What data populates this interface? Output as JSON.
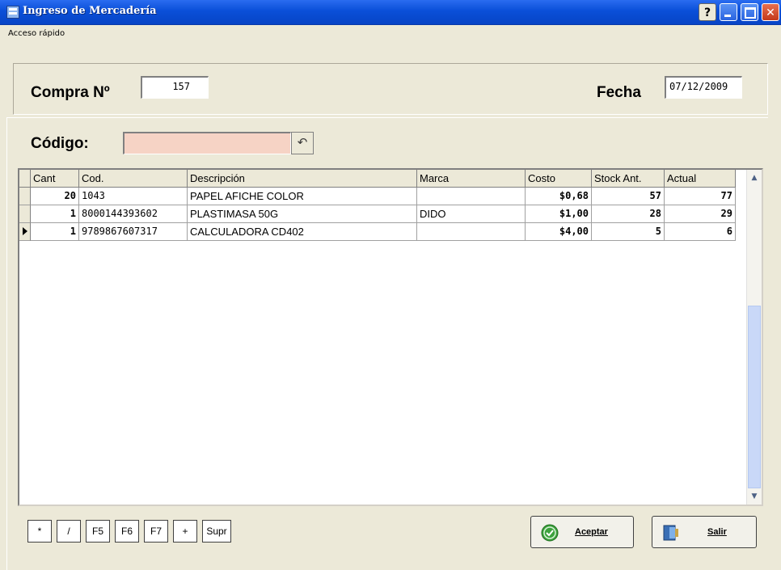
{
  "window": {
    "title": "Ingreso de Mercadería",
    "help_label": "?"
  },
  "menu": {
    "quick_access": "Acceso rápido"
  },
  "header": {
    "compra_label": "Compra Nº",
    "compra_value": "157",
    "fecha_label": "Fecha",
    "fecha_value": "07/12/2009"
  },
  "code": {
    "label": "Código:",
    "value": ""
  },
  "grid": {
    "columns": [
      "Cant",
      "Cod.",
      "Descripción",
      "Marca",
      "Costo",
      "Stock Ant.",
      "Actual"
    ],
    "rows": [
      {
        "cant": "20",
        "cod": "1043",
        "descripcion": "PAPEL AFICHE COLOR",
        "marca": "",
        "costo": "$0,68",
        "stock_ant": "57",
        "actual": "77"
      },
      {
        "cant": "1",
        "cod": "8000144393602",
        "descripcion": "PLASTIMASA 50G",
        "marca": "DIDO",
        "costo": "$1,00",
        "stock_ant": "28",
        "actual": "29"
      },
      {
        "cant": "1",
        "cod": "9789867607317",
        "descripcion": "CALCULADORA CD402",
        "marca": "",
        "costo": "$4,00",
        "stock_ant": "5",
        "actual": "6"
      }
    ],
    "current_row": 2
  },
  "keys": [
    "*",
    "/",
    "F5",
    "F6",
    "F7",
    "+",
    "Supr"
  ],
  "buttons": {
    "accept": "Aceptar",
    "exit": "Salir"
  },
  "colors": {
    "titlebar": "#0a4fd8",
    "form_bg": "#ece9d8",
    "code_input_bg": "#f6d3c5"
  }
}
